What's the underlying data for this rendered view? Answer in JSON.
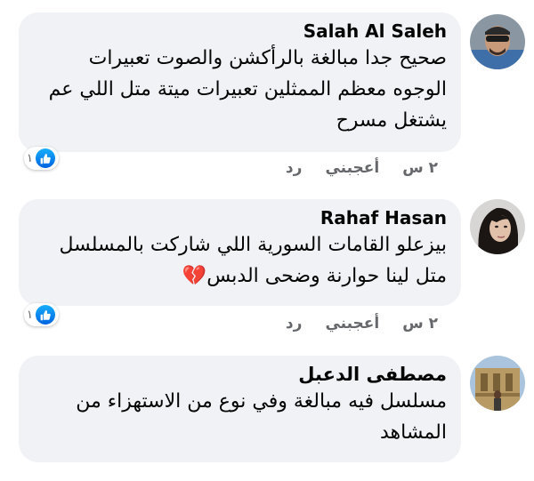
{
  "comments": [
    {
      "author": "Salah Al Saleh",
      "text": "صحيح جدا مبالغة بالرأكشن والصوت تعبيرات الوجوه معظم الممثلين تعبيرات ميتة متل اللي عم يشتغل مسرح",
      "time": "٢ س",
      "like_label": "أعجبني",
      "reply_label": "رد",
      "reaction_count": "١",
      "reaction_icon": "like-icon"
    },
    {
      "author": "Rahaf Hasan",
      "text": "بيزعلو القامات السورية اللي شاركت بالمسلسل متل لينا حوارنة وضحى الدبس",
      "emoji": "💔",
      "time": "٢ س",
      "like_label": "أعجبني",
      "reply_label": "رد",
      "reaction_count": "١",
      "reaction_icon": "like-icon"
    },
    {
      "author": "مصطفى الدعبل",
      "text": "مسلسل فيه مبالغة وفي نوع من الاستهزاء من المشاهد"
    }
  ],
  "colors": {
    "bubble": "#f0f2f5",
    "meta_text": "#65676b",
    "like_blue": "#1877f2"
  }
}
